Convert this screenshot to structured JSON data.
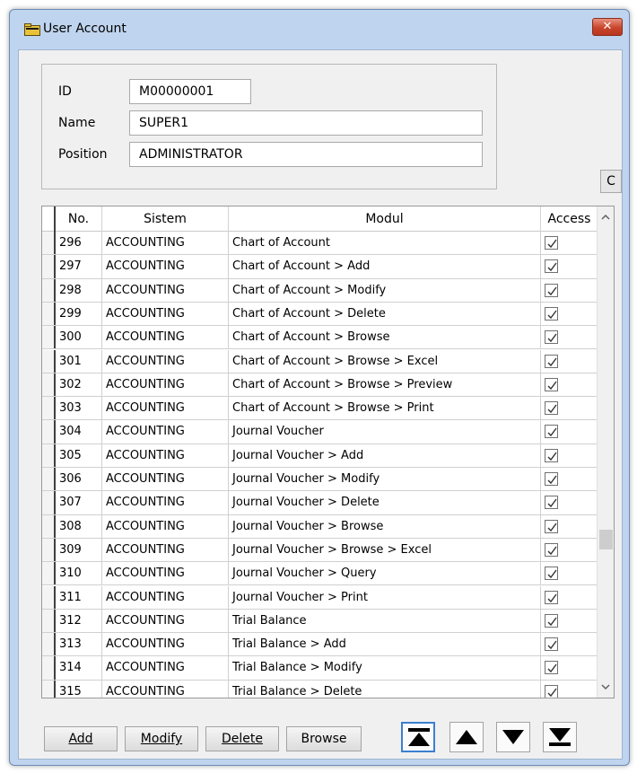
{
  "window": {
    "title": "User Account",
    "close_label": "✕"
  },
  "user": {
    "id_label": "ID",
    "id_value": "M00000001",
    "name_label": "Name",
    "name_value": "SUPER1",
    "position_label": "Position",
    "position_value": "ADMINISTRATOR"
  },
  "c_button": "C",
  "grid": {
    "columns": [
      "No.",
      "Sistem",
      "Modul",
      "Access"
    ],
    "rows": [
      {
        "no": "296",
        "sistem": "ACCOUNTING",
        "modul": "Chart of Account",
        "access": true
      },
      {
        "no": "297",
        "sistem": "ACCOUNTING",
        "modul": "Chart of Account > Add",
        "access": true
      },
      {
        "no": "298",
        "sistem": "ACCOUNTING",
        "modul": "Chart of Account > Modify",
        "access": true
      },
      {
        "no": "299",
        "sistem": "ACCOUNTING",
        "modul": "Chart of Account > Delete",
        "access": true
      },
      {
        "no": "300",
        "sistem": "ACCOUNTING",
        "modul": "Chart of Account > Browse",
        "access": true
      },
      {
        "no": "301",
        "sistem": "ACCOUNTING",
        "modul": "Chart of Account > Browse > Excel",
        "access": true
      },
      {
        "no": "302",
        "sistem": "ACCOUNTING",
        "modul": "Chart of Account > Browse > Preview",
        "access": true
      },
      {
        "no": "303",
        "sistem": "ACCOUNTING",
        "modul": "Chart of Account > Browse > Print",
        "access": true
      },
      {
        "no": "304",
        "sistem": "ACCOUNTING",
        "modul": "Journal Voucher",
        "access": true
      },
      {
        "no": "305",
        "sistem": "ACCOUNTING",
        "modul": "Journal Voucher > Add",
        "access": true
      },
      {
        "no": "306",
        "sistem": "ACCOUNTING",
        "modul": "Journal Voucher > Modify",
        "access": true
      },
      {
        "no": "307",
        "sistem": "ACCOUNTING",
        "modul": "Journal Voucher > Delete",
        "access": true
      },
      {
        "no": "308",
        "sistem": "ACCOUNTING",
        "modul": "Journal Voucher > Browse",
        "access": true
      },
      {
        "no": "309",
        "sistem": "ACCOUNTING",
        "modul": "Journal Voucher > Browse > Excel",
        "access": true
      },
      {
        "no": "310",
        "sistem": "ACCOUNTING",
        "modul": "Journal Voucher > Query",
        "access": true
      },
      {
        "no": "311",
        "sistem": "ACCOUNTING",
        "modul": "Journal Voucher > Print",
        "access": true
      },
      {
        "no": "312",
        "sistem": "ACCOUNTING",
        "modul": "Trial Balance",
        "access": true
      },
      {
        "no": "313",
        "sistem": "ACCOUNTING",
        "modul": "Trial Balance > Add",
        "access": true
      },
      {
        "no": "314",
        "sistem": "ACCOUNTING",
        "modul": "Trial Balance > Modify",
        "access": true
      },
      {
        "no": "315",
        "sistem": "ACCOUNTING",
        "modul": "Trial Balance > Delete",
        "access": true
      }
    ]
  },
  "buttons": {
    "add": "Add",
    "modify": "Modify",
    "delete": "Delete",
    "browse": "Browse"
  },
  "nav": [
    "first-record-icon",
    "previous-record-icon",
    "next-record-icon",
    "last-record-icon"
  ],
  "colors": {
    "title_bar": "#bfd4ee",
    "close_button": "#c8442c",
    "active_nav_border": "#3b7fd1"
  }
}
